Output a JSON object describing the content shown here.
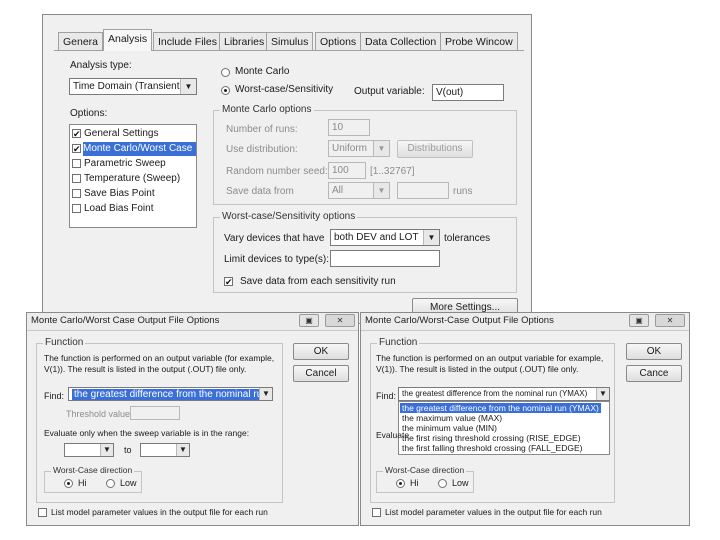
{
  "main": {
    "tabs": [
      "Genera",
      "Analysis",
      "Include Files",
      "Libraries",
      "Simulus",
      "Options",
      "Data Collection",
      "Probe Wincow"
    ],
    "active_tab": "Analysis",
    "analysis_type_label": "Analysis type:",
    "analysis_type_value": "Time Domain (Transient)",
    "options_label": "Options:",
    "options": [
      {
        "label": "General Settings",
        "checked": true,
        "selected": false
      },
      {
        "label": "Monte Carlo/Worst Case",
        "checked": true,
        "selected": true
      },
      {
        "label": "Parametric Sweep",
        "checked": false,
        "selected": false
      },
      {
        "label": "Temperature (Sweep)",
        "checked": false,
        "selected": false
      },
      {
        "label": "Save Bias Point",
        "checked": false,
        "selected": false
      },
      {
        "label": "Load Bias Foint",
        "checked": false,
        "selected": false
      }
    ],
    "radio_monte_carlo": "Monte Carlo",
    "radio_worst_case": "Worst-case/Sensitivity",
    "output_variable_label": "Output variable:",
    "output_variable_value": "V(out)",
    "mc_group_title": "Monte Carlo options",
    "num_runs_label": "Number of runs:",
    "num_runs_value": "10",
    "use_distribution_label": "Use distribution:",
    "use_distribution_value": "Uniform",
    "distributions_button": "Distributions",
    "seed_label": "Random number seed:",
    "seed_value": "100",
    "seed_range": "[1..32767]",
    "save_data_label": "Save data from",
    "save_data_value": "All",
    "runs_label": "runs",
    "wc_group_title": "Worst-case/Sensitivity options",
    "vary_label": "Vary devices that have",
    "vary_value": "both DEV and LOT",
    "tolerances_label": "tolerances",
    "limit_label": "Limit devices to type(s):",
    "save_sensitivity_label": "Save data from each sensitivity run",
    "more_settings_button": "More Settings..."
  },
  "dialog_left": {
    "title": "Monte Carlo/Worst Case Output File Options",
    "function_group": "Function",
    "desc1": "The function is performed on an output variable (for example,",
    "desc2": "V(1)). The result is listed in the output (.OUT) file only.",
    "find_label": "Find:",
    "find_value": "the greatest difference from the nominal run (YMAX)",
    "threshold_label": "Threshold value:",
    "evaluate_label": "Evaluate only when the sweep variable is in the range:",
    "to_label": "to",
    "direction_group": "Worst-Case direction",
    "hi_label": "Hi",
    "low_label": "Low",
    "list_model_label": "List model parameter values in the output file for each run",
    "ok_button": "OK",
    "cancel_button": "Cancel"
  },
  "dialog_right": {
    "title": "Monte Carlo/Worst-Case Output File Options",
    "function_group": "Function",
    "desc1": "The function is performed on an output variable for example,",
    "desc2": "V(1)). The result is listed in the output (.OUT) file only.",
    "find_label": "Find:",
    "find_value": "the greatest difference from the nominal run (YMAX)",
    "evaluate_label": "Evaluate",
    "dropdown_options": [
      "the greatest difference from the nominal run (YMAX)",
      "the maximum value (MAX)",
      "the minimum value (MIN)",
      "the first rising threshold crossing (RISE_EDGE)",
      "the first falling threshold crossing (FALL_EDGE)"
    ],
    "direction_group": "Worst-Case direction",
    "hi_label": "Hi",
    "low_label": "Low",
    "list_model_label": "List model parameter values in the output file for each run",
    "ok_button": "OK",
    "cancel_button": "Cance"
  }
}
